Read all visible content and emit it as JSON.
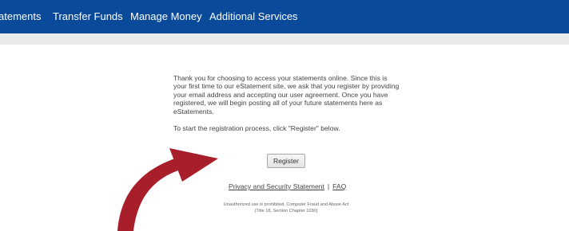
{
  "nav": {
    "items": [
      {
        "label": "atements"
      },
      {
        "label": "Transfer Funds"
      },
      {
        "label": "Manage Money"
      },
      {
        "label": "Additional Services"
      }
    ]
  },
  "content": {
    "intro": "Thank you for choosing to access your statements online. Since this is your first time to our eStatement site, we ask that you register by providing your email address and accepting our user agreement. Once you have registered, we will begin posting all of your future statements here as eStatements.",
    "instruction": "To start the registration process, click \"Register\" below.",
    "register_label": "Register"
  },
  "links": {
    "privacy": "Privacy and Security Statement",
    "separator": "|",
    "faq": "FAQ"
  },
  "legal": {
    "line1": "Unauthorized use is prohibited. Computer Fraud and Abuse Act",
    "line2": "(Title 18, Section Chapter 1030)"
  },
  "colors": {
    "nav_background": "#0a4a9a",
    "arrow": "#a81e2b"
  },
  "icons": {
    "pointer_arrow": "curved-arrow-icon"
  }
}
